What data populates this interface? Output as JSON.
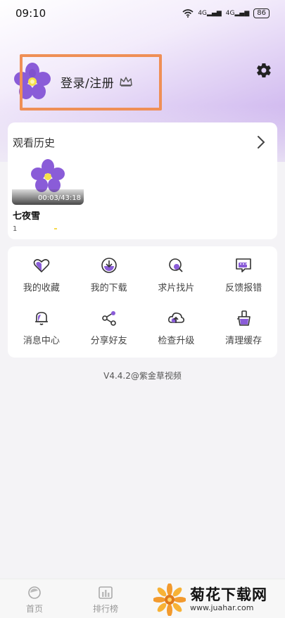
{
  "status_bar": {
    "time": "09:10",
    "signal1_label": "4G",
    "signal2_label": "4G",
    "battery": "86"
  },
  "profile": {
    "login_label": "登录/注册",
    "crown_icon": "crown-icon",
    "settings_icon": "gear-icon"
  },
  "history": {
    "title": "观看历史",
    "items": [
      {
        "name": "七夜雪",
        "duration": "00:03/43:18",
        "progress_text": "1"
      }
    ]
  },
  "features": {
    "items": [
      {
        "label": "我的收藏",
        "icon": "heart-icon"
      },
      {
        "label": "我的下载",
        "icon": "download-icon"
      },
      {
        "label": "求片找片",
        "icon": "search-film-icon"
      },
      {
        "label": "反馈报错",
        "icon": "feedback-icon"
      },
      {
        "label": "消息中心",
        "icon": "bell-icon"
      },
      {
        "label": "分享好友",
        "icon": "share-icon"
      },
      {
        "label": "检查升级",
        "icon": "cloud-upload-icon"
      },
      {
        "label": "清理缓存",
        "icon": "broom-icon"
      }
    ]
  },
  "version": "V4.4.2@紫金草视频",
  "bottom_nav": {
    "items": [
      {
        "label": "首页",
        "icon": "home-icon"
      },
      {
        "label": "排行榜",
        "icon": "ranking-icon"
      }
    ]
  },
  "watermark": {
    "title": "菊花下载网",
    "url": "www.juahar.com"
  },
  "colors": {
    "accent": "#8a5cd8",
    "highlight_box": "#ef8f56"
  }
}
